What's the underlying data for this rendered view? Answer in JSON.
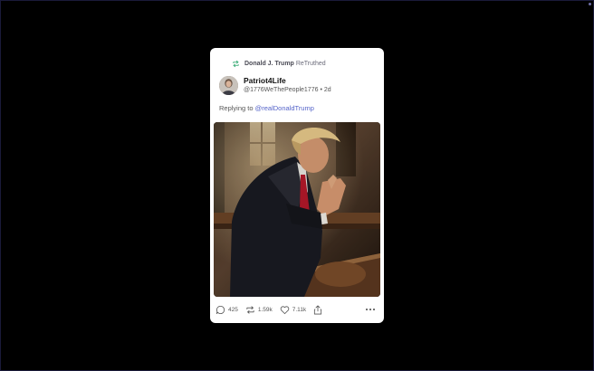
{
  "retruth": {
    "name": "Donald J. Trump",
    "label": "ReTruthed",
    "icon": "retruth-icon"
  },
  "post": {
    "display_name": "Patriot4Life",
    "handle": "@1776WeThePeople1776",
    "separator": "•",
    "age": "2d",
    "reply_prefix": "Replying to",
    "reply_target": "@realDonaldTrump",
    "image_description_icon": "praying-man-image"
  },
  "actions": {
    "replies": "425",
    "retruths": "1.59k",
    "likes": "7.11k"
  },
  "colors": {
    "background": "#000000",
    "card": "#ffffff",
    "link": "#5463c9",
    "retruth_icon": "#3fae7a"
  }
}
